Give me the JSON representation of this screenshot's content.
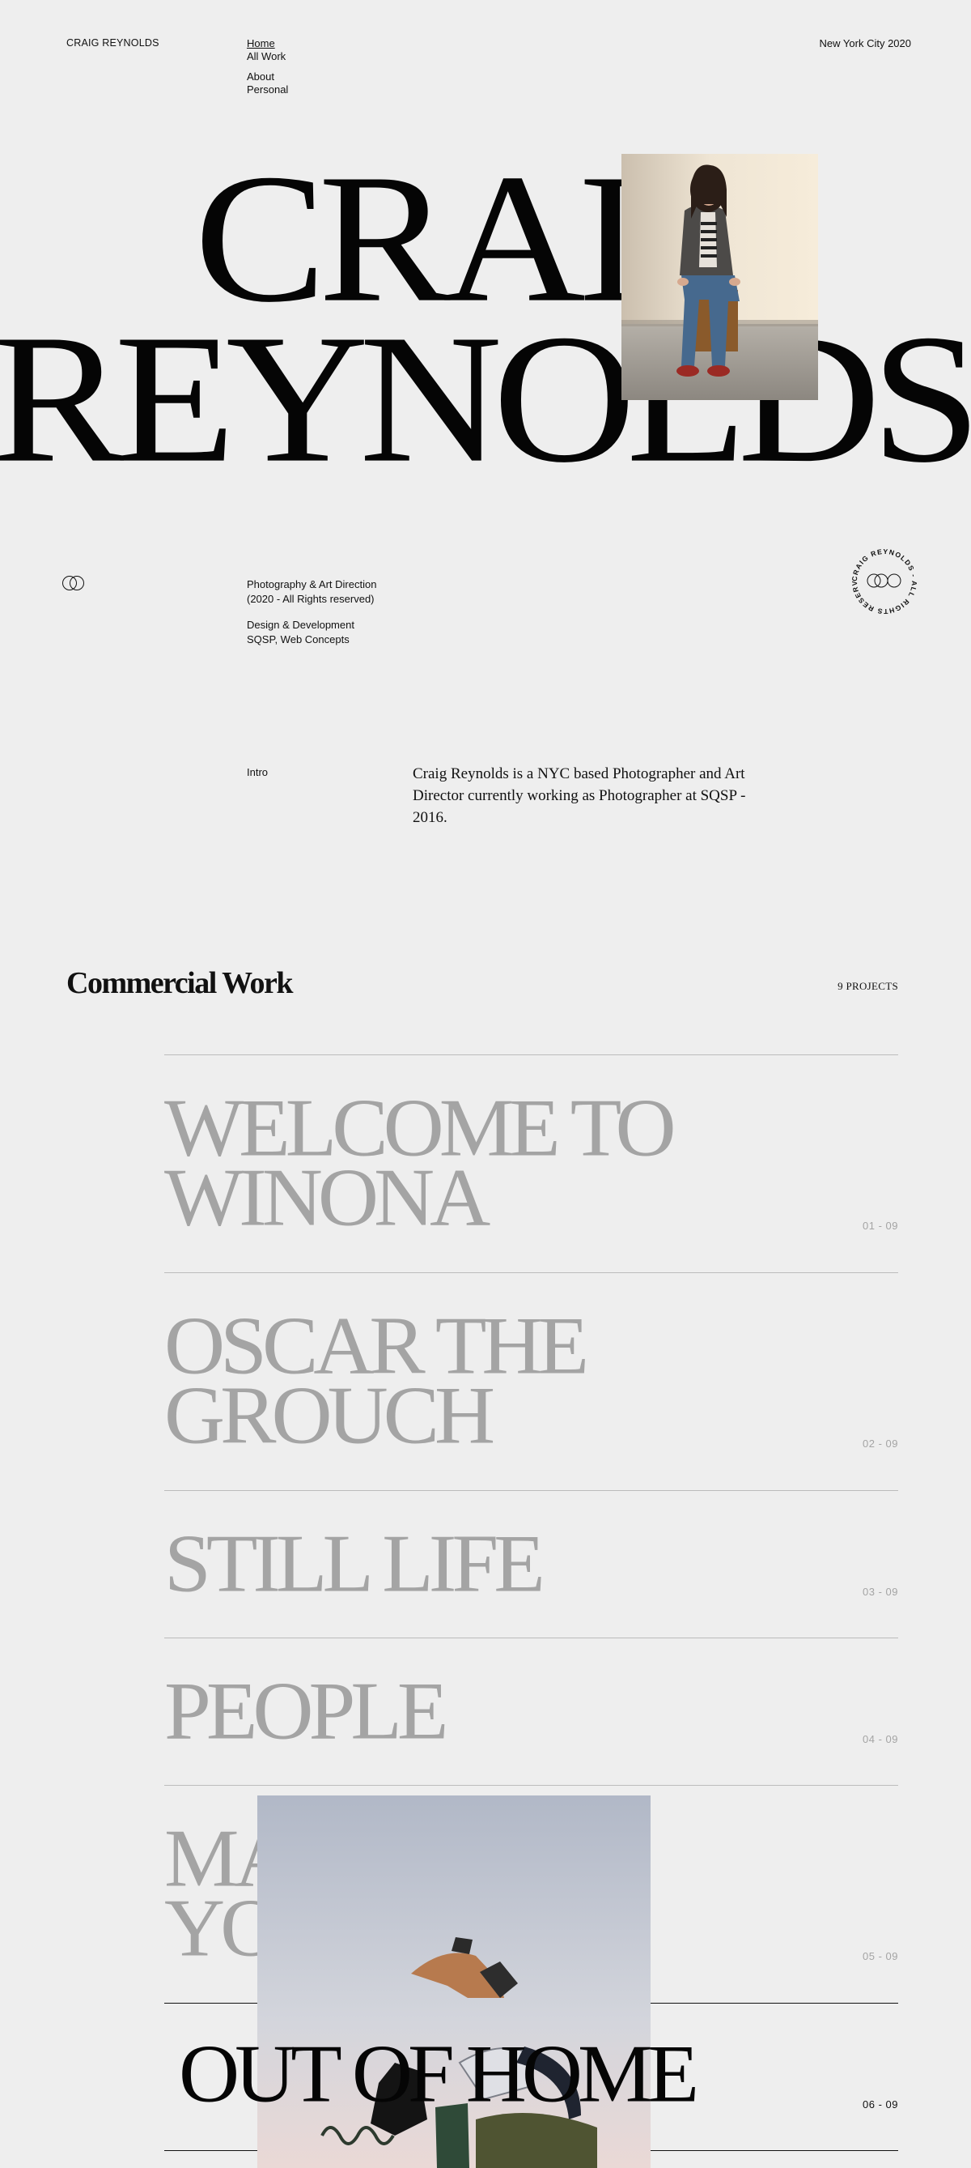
{
  "header": {
    "brand": "CRAIG REYNOLDS",
    "nav": {
      "home": "Home",
      "all_work": "All Work",
      "about": "About",
      "personal": "Personal"
    },
    "location": "New York City 2020"
  },
  "hero": {
    "line1": "CRAI",
    "line2": "REYNOLDS"
  },
  "services": {
    "line1": "Photography & Art Direction",
    "line2": "(2020 - All Rights reserved)",
    "line3": "Design & Development",
    "line4": "SQSP, Web Concepts"
  },
  "badge": {
    "ring_text": "CRAIG REYNOLDS - ALL RIGHTS RESERVED - 2020 -"
  },
  "intro": {
    "label": "Intro",
    "text": "Craig Reynolds is a NYC based Photographer and Art Director currently working as Photographer at SQSP - 2016."
  },
  "commercial": {
    "title": "Commercial Work",
    "count": "9 PROJECTS",
    "projects": [
      {
        "title_l1": "WELCOME TO",
        "title_l2": "WINONA",
        "num": "01 - 09"
      },
      {
        "title_l1": "OSCAR THE",
        "title_l2": "GROUCH",
        "num": "02 - 09"
      },
      {
        "title_l1": "STILL LIFE",
        "title_l2": "",
        "num": "03 - 09"
      },
      {
        "title_l1": "PEOPLE",
        "title_l2": "",
        "num": "04 - 09"
      },
      {
        "title_l1": "MA",
        "title_l2": "YO",
        "num": "05 - 09"
      },
      {
        "title_l1": "OUT OF HOME",
        "title_l2": "",
        "num": "06 - 09"
      }
    ]
  },
  "colors": {
    "background": "#eeeeee",
    "text": "#111111",
    "muted": "#a4a4a4",
    "rule": "#bcbcbc"
  }
}
